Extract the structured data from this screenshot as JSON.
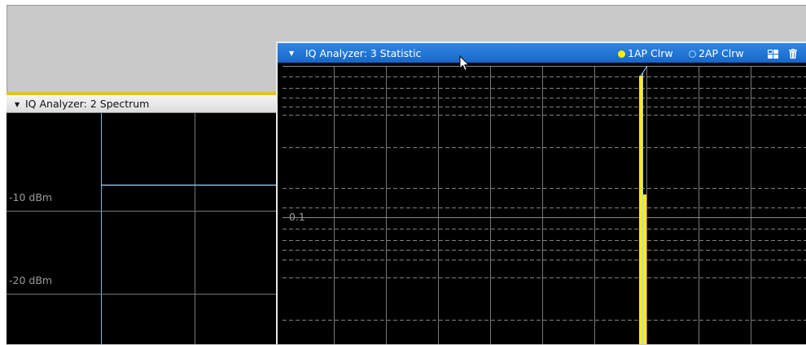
{
  "spectrum_window": {
    "title": "IQ Analyzer: 2 Spectrum",
    "y_labels": [
      "-10 dBm",
      "-20 dBm"
    ]
  },
  "statistic_window": {
    "title": "IQ Analyzer: 3 Statistic",
    "traces": [
      {
        "label": "1AP Clrw",
        "color": "#ffee00"
      },
      {
        "label": "2AP Clrw",
        "color": "#9fd4ff"
      }
    ],
    "y_label": "0.1",
    "icons": [
      "layout-split-icon",
      "delete-icon"
    ]
  },
  "colors": {
    "accent": "#e6c02a",
    "active_title": "#1f78d8",
    "grid": "#7a7a7a",
    "trace1": "#ffee00",
    "trace2": "#9fd4ff"
  }
}
